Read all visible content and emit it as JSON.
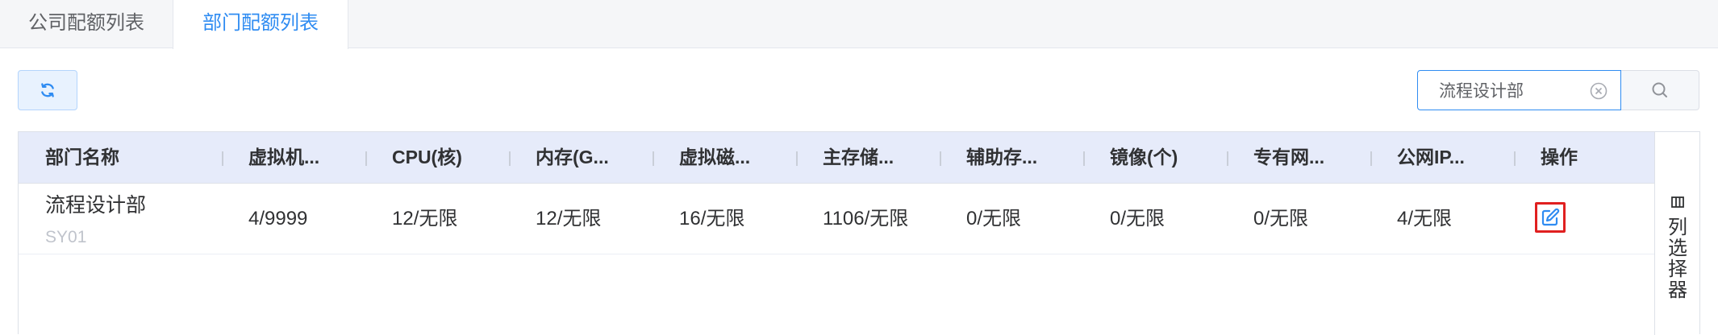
{
  "tabs": [
    {
      "label": "公司配额列表",
      "active": false
    },
    {
      "label": "部门配额列表",
      "active": true
    }
  ],
  "toolbar": {
    "refresh_icon": "refresh-icon",
    "search": {
      "value": "流程设计部",
      "placeholder": ""
    },
    "clear_icon": "clear-circle-icon",
    "search_icon": "search-icon"
  },
  "table": {
    "headers": [
      "部门名称",
      "虚拟机...",
      "CPU(核)",
      "内存(G...",
      "虚拟磁...",
      "主存储...",
      "辅助存...",
      "镜像(个)",
      "专有网...",
      "公网IP...",
      "操作"
    ],
    "rows": [
      {
        "name": "流程设计部",
        "code": "SY01",
        "cells": [
          "4/9999",
          "12/无限",
          "12/无限",
          "16/无限",
          "1106/无限",
          "0/无限",
          "0/无限",
          "0/无限",
          "4/无限"
        ],
        "action_icon": "edit-icon"
      }
    ]
  },
  "column_selector": {
    "label": "列选择器",
    "icon": "columns-icon"
  },
  "colors": {
    "accent": "#2f8cf2",
    "header_bg": "#e6ebfa",
    "highlight": "#e02020"
  }
}
